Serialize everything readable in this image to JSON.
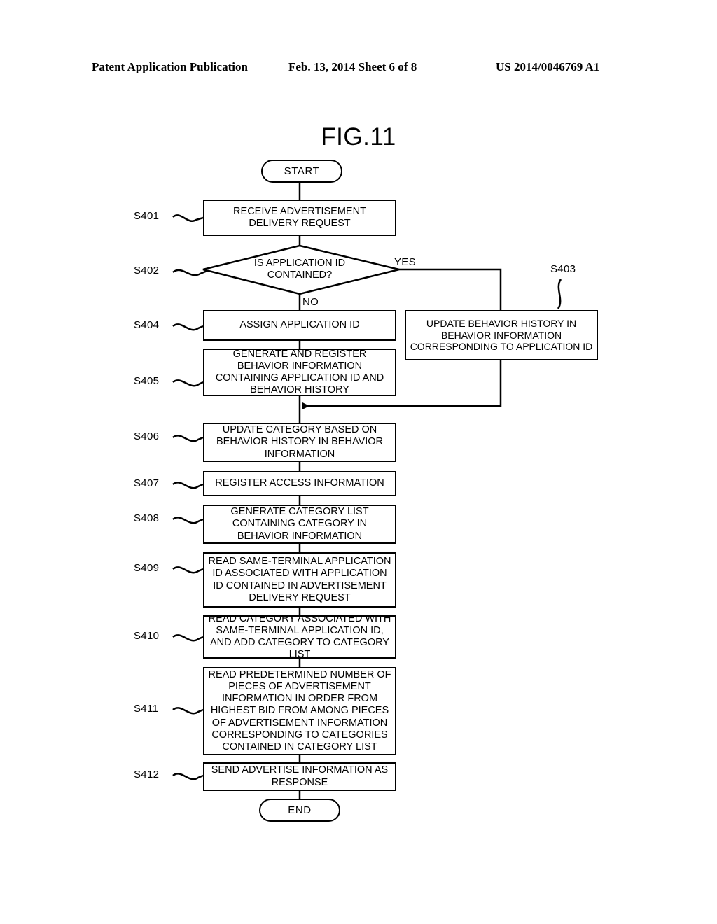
{
  "header": {
    "left": "Patent Application Publication",
    "middle": "Feb. 13, 2014  Sheet 6 of 8",
    "right": "US 2014/0046769 A1"
  },
  "figure": {
    "title": "FIG.11",
    "start_label": "START",
    "end_label": "END",
    "branch_yes": "YES",
    "branch_no": "NO",
    "steps": [
      {
        "id": "S401",
        "text": "RECEIVE ADVERTISEMENT DELIVERY REQUEST",
        "shape": "process"
      },
      {
        "id": "S402",
        "text": "IS APPLICATION ID CONTAINED?",
        "shape": "decision"
      },
      {
        "id": "S403",
        "text": "UPDATE BEHAVIOR HISTORY IN BEHAVIOR INFORMATION CORRESPONDING TO APPLICATION ID",
        "shape": "process"
      },
      {
        "id": "S404",
        "text": "ASSIGN APPLICATION ID",
        "shape": "process"
      },
      {
        "id": "S405",
        "text": "GENERATE AND REGISTER BEHAVIOR INFORMATION CONTAINING APPLICATION ID AND BEHAVIOR HISTORY",
        "shape": "process"
      },
      {
        "id": "S406",
        "text": "UPDATE CATEGORY BASED ON BEHAVIOR HISTORY IN BEHAVIOR INFORMATION",
        "shape": "process"
      },
      {
        "id": "S407",
        "text": "REGISTER ACCESS INFORMATION",
        "shape": "process"
      },
      {
        "id": "S408",
        "text": "GENERATE CATEGORY LIST CONTAINING CATEGORY IN BEHAVIOR INFORMATION",
        "shape": "process"
      },
      {
        "id": "S409",
        "text": "READ SAME-TERMINAL APPLICATION ID ASSOCIATED WITH APPLICATION ID CONTAINED IN ADVERTISEMENT DELIVERY REQUEST",
        "shape": "process"
      },
      {
        "id": "S410",
        "text": "READ CATEGORY ASSOCIATED WITH SAME-TERMINAL APPLICATION ID, AND ADD CATEGORY TO CATEGORY LIST",
        "shape": "process"
      },
      {
        "id": "S411",
        "text": "READ PREDETERMINED NUMBER OF PIECES OF ADVERTISEMENT INFORMATION IN ORDER FROM HIGHEST BID FROM AMONG PIECES OF ADVERTISEMENT INFORMATION CORRESPONDING TO CATEGORIES CONTAINED IN CATEGORY LIST",
        "shape": "process"
      },
      {
        "id": "S412",
        "text": "SEND ADVERTISE INFORMATION AS RESPONSE",
        "shape": "process"
      }
    ]
  },
  "colors": {
    "ink": "#000000",
    "paper": "#ffffff"
  }
}
